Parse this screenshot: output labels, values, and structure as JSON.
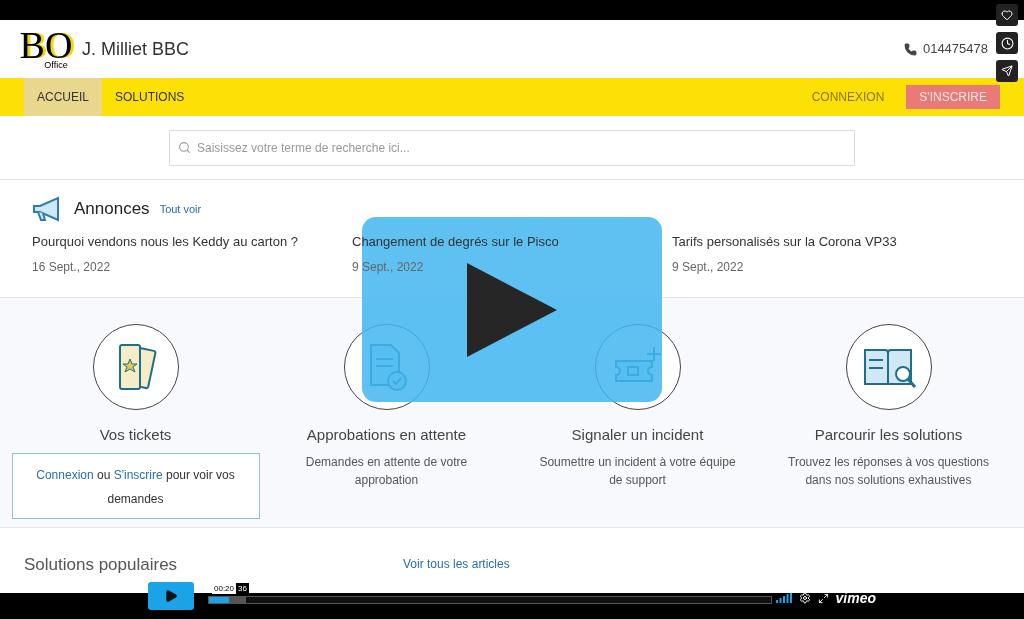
{
  "header": {
    "logo_letters": "BO",
    "logo_sub": "Office",
    "company": "J. Milliet BBC",
    "phone": "014475478"
  },
  "nav": {
    "items": [
      {
        "label": "ACCUEIL",
        "selected": true
      },
      {
        "label": "SOLUTIONS",
        "selected": false
      }
    ],
    "login": "CONNEXION",
    "signup": "S'INSCRIRE"
  },
  "search": {
    "placeholder": "Saisissez votre terme de recherche ici..."
  },
  "announcements": {
    "title": "Annonces",
    "see_all": "Tout voir",
    "items": [
      {
        "title": "Pourquoi vendons nous les Keddy au carton ?",
        "date": "16 Sept., 2022"
      },
      {
        "title": "Changement de degrés sur le Pisco",
        "date": "9 Sept., 2022"
      },
      {
        "title": "Tarifs personalisés sur la Corona VP33",
        "date": "9 Sept., 2022"
      }
    ]
  },
  "tiles": [
    {
      "kind": "tickets",
      "title": "Vos tickets",
      "login_link": "Connexion",
      "or": "ou",
      "signup_link": "S'inscrire",
      "tail": "pour voir vos demandes"
    },
    {
      "kind": "approval",
      "title": "Approbations en attente",
      "description": "Demandes en attente de votre approbation"
    },
    {
      "kind": "incident",
      "title": "Signaler un incident",
      "description": "Soumettre un incident à votre équipe de support"
    },
    {
      "kind": "browse",
      "title": "Parcourir les solutions",
      "description": "Trouvez les réponses à vos questions dans nos solutions exhaustives"
    }
  ],
  "popular": {
    "title": "Solutions populaires",
    "see_all": "Voir tous les articles"
  },
  "player": {
    "time": "00:20",
    "badge": "36",
    "played": {
      "level": 0.036
    },
    "loaded": {
      "level": 0.065
    },
    "brand": "vimeo"
  }
}
